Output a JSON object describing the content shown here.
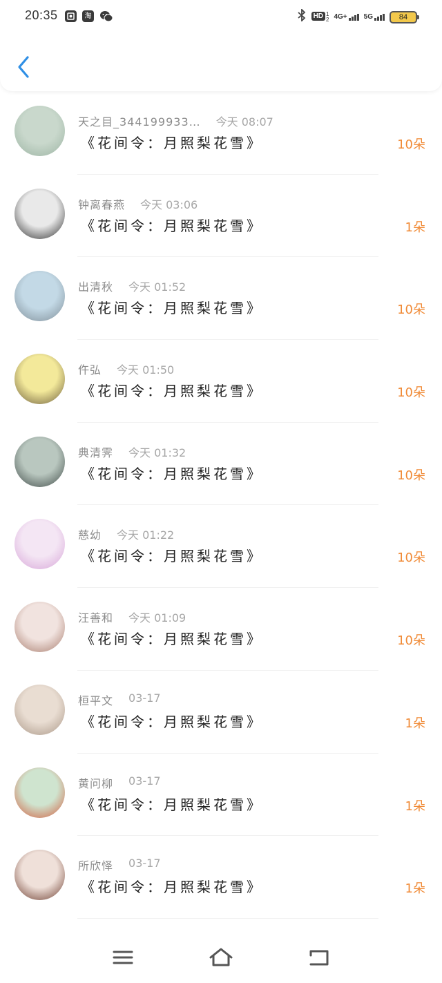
{
  "status_bar": {
    "time": "20:35",
    "left_icons": [
      "app-icon",
      "taobao-icon",
      "wechat-icon"
    ],
    "taobao_glyph": "淘",
    "hd_label": "HD",
    "hd_sup": "1",
    "hd_sub": "2",
    "network_1": "4G+",
    "network_2": "5G",
    "battery": "84"
  },
  "list": [
    {
      "name": "天之目_344199933…",
      "time": "今天 08:07",
      "title": "《花间令：月照梨花雪》",
      "amount": "10朵",
      "avatar_color": [
        "#c9d8cc",
        "#9bb3a2"
      ]
    },
    {
      "name": "钟离春燕",
      "time": "今天 03:06",
      "title": "《花间令：月照梨花雪》",
      "amount": "1朵",
      "avatar_color": [
        "#e9e9e9",
        "#2c2c2c"
      ]
    },
    {
      "name": "出清秋",
      "time": "今天 01:52",
      "title": "《花间令：月照梨花雪》",
      "amount": "10朵",
      "avatar_color": [
        "#c3d9e6",
        "#7d8c96"
      ]
    },
    {
      "name": "仵弘",
      "time": "今天 01:50",
      "title": "《花间令：月照梨花雪》",
      "amount": "10朵",
      "avatar_color": [
        "#f3e99a",
        "#6b5b3a"
      ]
    },
    {
      "name": "典清霁",
      "time": "今天 01:32",
      "title": "《花间令：月照梨花雪》",
      "amount": "10朵",
      "avatar_color": [
        "#b9c7bf",
        "#3f4a47"
      ]
    },
    {
      "name": "慈幼",
      "time": "今天 01:22",
      "title": "《花间令：月照梨花雪》",
      "amount": "10朵",
      "avatar_color": [
        "#f4e6f4",
        "#d7a4d8"
      ]
    },
    {
      "name": "汪善和",
      "time": "今天 01:09",
      "title": "《花间令：月照梨花雪》",
      "amount": "10朵",
      "avatar_color": [
        "#f1e3df",
        "#a77b6c"
      ]
    },
    {
      "name": "桓平文",
      "time": "03-17",
      "title": "《花间令：月照梨花雪》",
      "amount": "1朵",
      "avatar_color": [
        "#e9ddd2",
        "#a89585"
      ]
    },
    {
      "name": "黄问柳",
      "time": "03-17",
      "title": "《花间令：月照梨花雪》",
      "amount": "1朵",
      "avatar_color": [
        "#cfe4cf",
        "#d25b3b"
      ]
    },
    {
      "name": "所欣怿",
      "time": "03-17",
      "title": "《花间令：月照梨花雪》",
      "amount": "1朵",
      "avatar_color": [
        "#efe0d9",
        "#6b3a2c"
      ]
    }
  ],
  "navbar": {
    "icons": [
      "menu-icon",
      "home-icon",
      "back-icon"
    ]
  },
  "colors": {
    "accent_back": "#2f8fe5",
    "amount": "#f08a36"
  }
}
